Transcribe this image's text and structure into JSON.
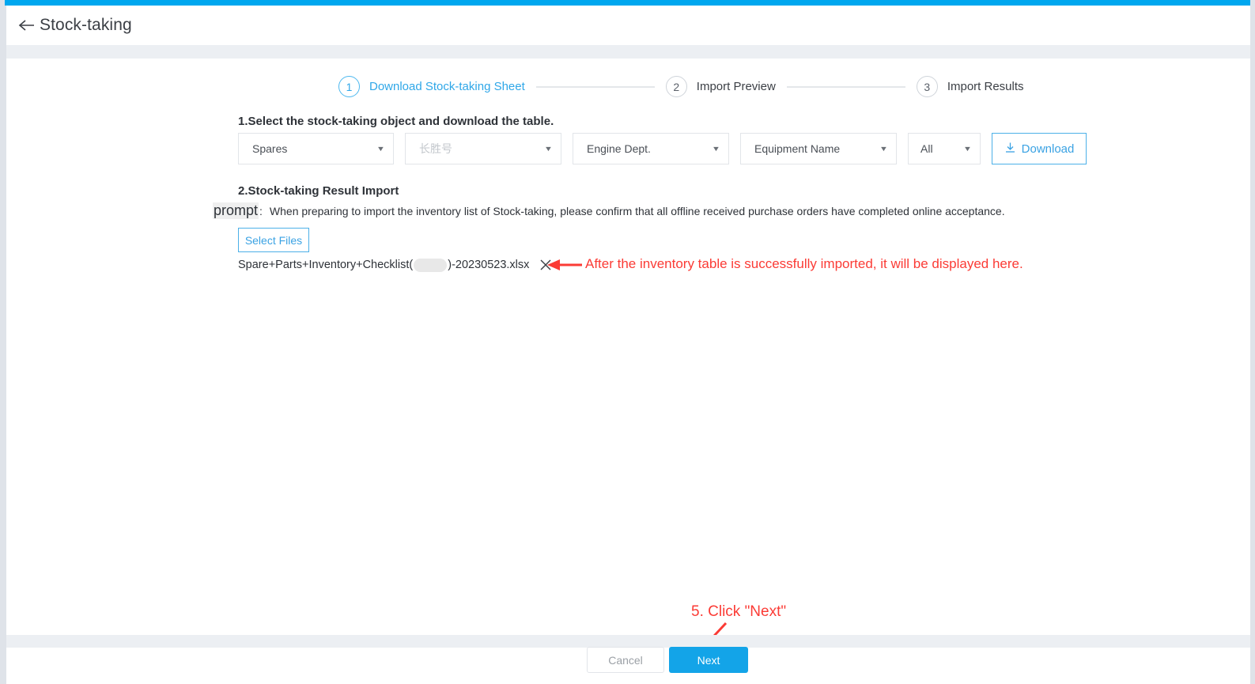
{
  "header": {
    "back_icon": "back-arrow-icon",
    "title": "Stock-taking"
  },
  "stepper": {
    "steps": [
      {
        "number": "1",
        "label": "Download Stock-taking Sheet",
        "active": true
      },
      {
        "number": "2",
        "label": "Import Preview",
        "active": false
      },
      {
        "number": "3",
        "label": "Import Results",
        "active": false
      }
    ]
  },
  "section1": {
    "title": "1.Select the stock-taking object and download the table.",
    "filters": [
      {
        "value": "Spares",
        "placeholder": false
      },
      {
        "value": "长胜号",
        "placeholder": true
      },
      {
        "value": "Engine Dept.",
        "placeholder": false
      },
      {
        "value": "Equipment Name",
        "placeholder": false
      },
      {
        "value": "All",
        "placeholder": false
      }
    ],
    "download_label": "Download",
    "download_icon": "download-icon"
  },
  "section2": {
    "title": "2.Stock-taking Result Import",
    "prompt_word": "prompt",
    "prompt_colon": ":",
    "prompt_text": "When preparing to import the inventory list of Stock-taking, please confirm that all offline received purchase orders have completed online acceptance.",
    "select_files_label": "Select Files",
    "file": {
      "name_before": "Spare+Parts+Inventory+Checklist(",
      "name_after": ")-20230523.xlsx",
      "remove_icon": "close-icon"
    }
  },
  "annotations": {
    "file_note": "After the inventory table is successfully imported, it will be displayed here.",
    "next_note": "5. Click \"Next\"",
    "color": "#fb3b35"
  },
  "footer": {
    "cancel_label": "Cancel",
    "next_label": "Next"
  },
  "colors": {
    "accent": "#00a7ef",
    "primary_button": "#13a4e8",
    "link": "#3aa2e3",
    "page_bg": "#dfe3e9",
    "band": "#eceff3"
  }
}
